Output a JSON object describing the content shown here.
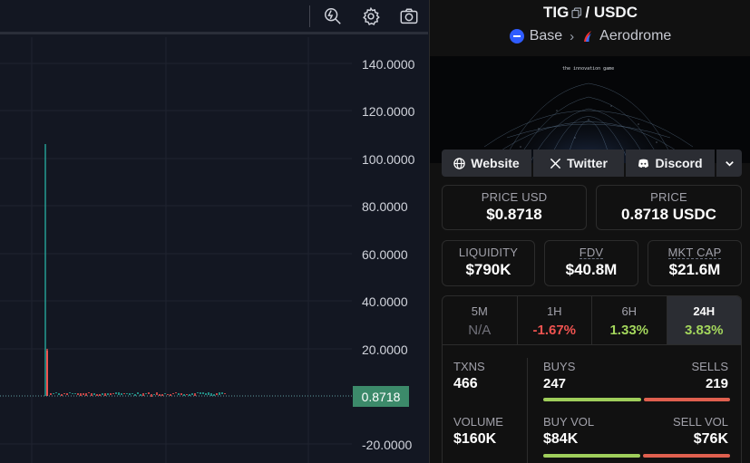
{
  "toolbar": {
    "icons": [
      "replay-icon",
      "gear-icon",
      "camera-icon"
    ]
  },
  "chart": {
    "y_ticks": [
      "140.0000",
      "120.0000",
      "100.0000",
      "80.0000",
      "60.0000",
      "40.0000",
      "20.0000",
      "-20.0000"
    ],
    "current_price": "0.8718",
    "colors": {
      "up": "#26a69a",
      "down": "#ef5350",
      "price_tag": "#3c8a6a"
    }
  },
  "pair": {
    "base": "TIG",
    "separator": "/",
    "quote": "USDC",
    "chain": "Base",
    "dex": "Aerodrome"
  },
  "banner": {
    "caption": "the innovation game"
  },
  "links": {
    "website": "Website",
    "twitter": "Twitter",
    "discord": "Discord"
  },
  "price": {
    "usd_label": "PRICE USD",
    "usd_value": "$0.8718",
    "native_label": "PRICE",
    "native_value": "0.8718 USDC"
  },
  "metrics": {
    "liquidity_label": "LIQUIDITY",
    "liquidity_value": "$790K",
    "fdv_label": "FDV",
    "fdv_value": "$40.8M",
    "mcap_label": "MKT CAP",
    "mcap_value": "$21.6M"
  },
  "tabs": [
    {
      "label": "5M",
      "value": "N/A",
      "color": "#71717a"
    },
    {
      "label": "1H",
      "value": "-1.67%",
      "color": "#ef5350"
    },
    {
      "label": "6H",
      "value": "1.33%",
      "color": "#a3d65c"
    },
    {
      "label": "24H",
      "value": "3.83%",
      "color": "#a3d65c"
    }
  ],
  "stats": {
    "txns_label": "TXNS",
    "txns_value": "466",
    "buys_label": "BUYS",
    "buys_value": "247",
    "sells_label": "SELLS",
    "sells_value": "219",
    "volume_label": "VOLUME",
    "volume_value": "$160K",
    "buy_vol_label": "BUY VOL",
    "buy_vol_value": "$84K",
    "sell_vol_label": "SELL VOL",
    "sell_vol_value": "$76K",
    "buy_color": "#9fce5b",
    "sell_color": "#e0604f"
  }
}
